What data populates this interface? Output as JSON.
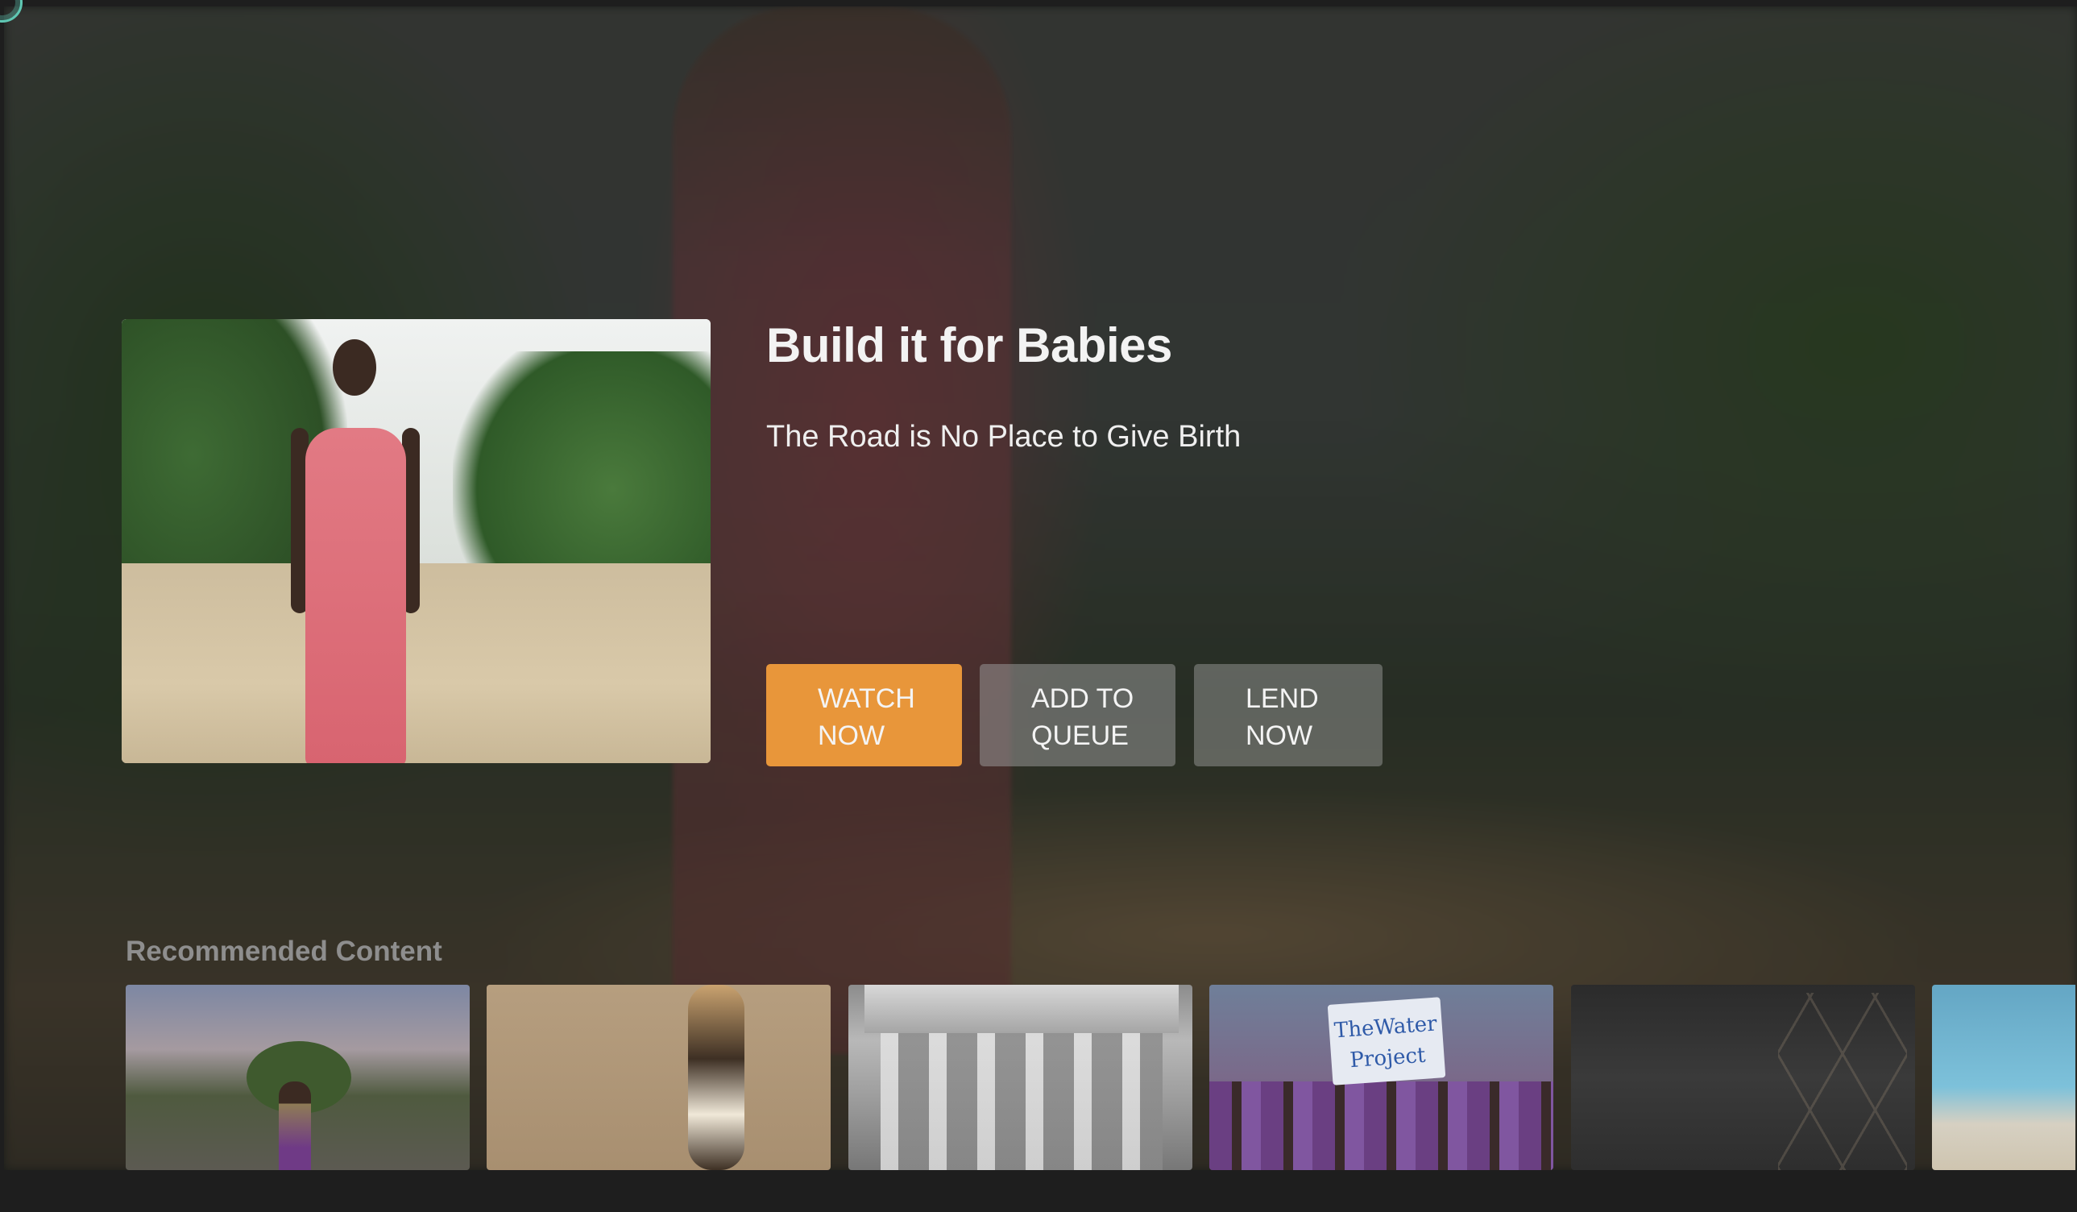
{
  "hero": {
    "title": "Build it for Babies",
    "subtitle": "The Road is No Place to Give Birth",
    "image_alt": "Pregnant woman in a pink dress standing on a dirt road"
  },
  "actions": {
    "watch": {
      "line1": "WATCH",
      "line2": "NOW"
    },
    "queue": {
      "line1": "ADD TO",
      "line2": "QUEUE"
    },
    "lend": {
      "line1": "LEND",
      "line2": "NOW"
    }
  },
  "recommended": {
    "label": "Recommended Content",
    "thumb4_banner": {
      "line1": "TheWater",
      "line2": "Project"
    }
  },
  "colors": {
    "accent": "#e8963a",
    "secondary_button": "#a0a0a0",
    "logo": "#5fc7b3"
  },
  "icons": {
    "corner": "app-logo-icon"
  }
}
